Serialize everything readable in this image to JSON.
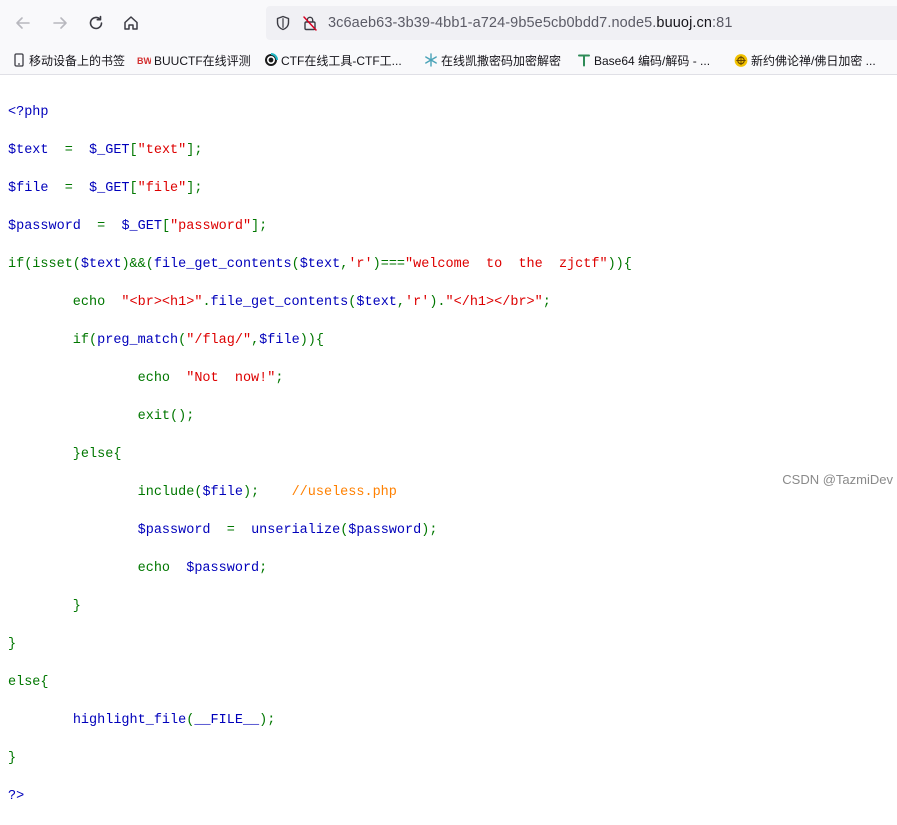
{
  "browser": {
    "url_prefix": "3c6aeb63-3b39-4bb1-a724-9b5e5cb0bdd7.node5.",
    "url_host": "buuoj.cn",
    "url_suffix": ":81",
    "icons": {
      "back": "arrow-left-icon",
      "forward": "arrow-right-icon",
      "reload": "reload-icon",
      "home": "home-icon",
      "shield": "shield-icon",
      "lock": "insecure-lock-icon"
    }
  },
  "bookmarks": [
    {
      "label": "移动设备上的书签",
      "icon": "mobile-icon"
    },
    {
      "label": "BUUCTF在线评测",
      "icon": "buuctf-icon"
    },
    {
      "label": "CTF在线工具-CTF工...",
      "icon": "ctf-tools-icon"
    },
    {
      "label": "在线凯撒密码加密解密",
      "icon": "snowflake-icon"
    },
    {
      "label": "Base64 编码/解码 - ...",
      "icon": "base64-icon"
    },
    {
      "label": "新约佛论禅/佛日加密 ...",
      "icon": "buddha-icon"
    }
  ],
  "code": {
    "l1": "<?php",
    "l2_var": "$text",
    "l2_op": "  =  ",
    "l2_fn": "$_GET",
    "l2_b1": "[",
    "l2_s": "\"text\"",
    "l2_b2": "];",
    "l3_var": "$file",
    "l3_op": "  =  ",
    "l3_fn": "$_GET",
    "l3_b1": "[",
    "l3_s": "\"file\"",
    "l3_b2": "];",
    "l4_var": "$password",
    "l4_op": "  =  ",
    "l4_fn": "$_GET",
    "l4_b1": "[",
    "l4_s": "\"password\"",
    "l4_b2": "];",
    "l5_a": "if(isset(",
    "l5_b": "$text",
    "l5_c": ")&&(",
    "l5_d": "file_get_contents",
    "l5_e": "(",
    "l5_f": "$text",
    "l5_g": ",",
    "l5_h": "'r'",
    "l5_i": ")===",
    "l5_j": "\"welcome  to  the  zjctf\"",
    "l5_k": ")){",
    "l6_a": "        echo  ",
    "l6_b": "\"<br><h1>\"",
    "l6_c": ".",
    "l6_d": "file_get_contents",
    "l6_e": "(",
    "l6_f": "$text",
    "l6_g": ",",
    "l6_h": "'r'",
    "l6_i": ").",
    "l6_j": "\"</h1></br>\"",
    "l6_k": ";",
    "l7_a": "        if(",
    "l7_b": "preg_match",
    "l7_c": "(",
    "l7_d": "\"/flag/\"",
    "l7_e": ",",
    "l7_f": "$file",
    "l7_g": ")){",
    "l8_a": "                echo  ",
    "l8_b": "\"Not  now!\"",
    "l8_c": ";",
    "l9_a": "                exit();",
    "l10_a": "        }else{",
    "l11_a": "                include(",
    "l11_b": "$file",
    "l11_c": ");    ",
    "l11_d": "//useless.php",
    "l12_a": "                ",
    "l12_b": "$password",
    "l12_c": "  =  ",
    "l12_d": "unserialize",
    "l12_e": "(",
    "l12_f": "$password",
    "l12_g": ");",
    "l13_a": "                echo  ",
    "l13_b": "$password",
    "l13_c": ";",
    "l14_a": "        }",
    "l15_a": "}",
    "l16_a": "else{",
    "l17_a": "        ",
    "l17_b": "highlight_file",
    "l17_c": "(",
    "l17_d": "__FILE__",
    "l17_e": ");",
    "l18_a": "}",
    "l19_a": "?>"
  },
  "watermark": "CSDN @TazmiDev",
  "colors": {
    "keyword": "#007700",
    "variable": "#0000bb",
    "string": "#dd0000",
    "comment": "#ff8000"
  }
}
